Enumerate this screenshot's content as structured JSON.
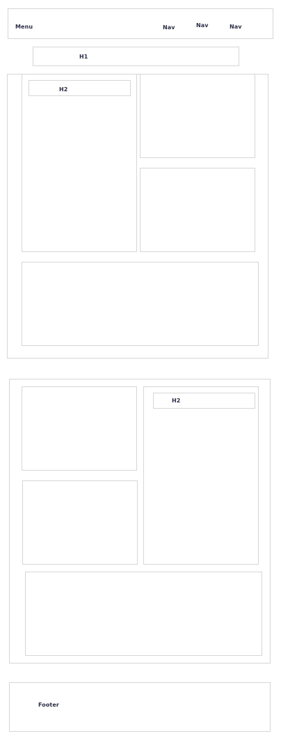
{
  "header": {
    "menu_label": "Menu",
    "nav_items": [
      {
        "label": "Nav"
      },
      {
        "label": "Nav"
      },
      {
        "label": "Nav"
      }
    ]
  },
  "page_title": {
    "label": "H1"
  },
  "section_one": {
    "card_heading": "H2"
  },
  "section_two": {
    "card_heading": "H2"
  },
  "footer": {
    "label": "Footer"
  }
}
